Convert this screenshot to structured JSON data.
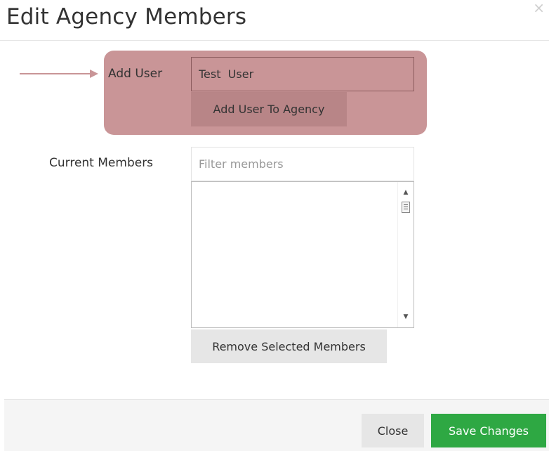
{
  "dialog": {
    "title": "Edit Agency Members",
    "close_icon": "×"
  },
  "add_user": {
    "label": "Add User",
    "input_value": "Test  User",
    "button_label": "Add User To Agency",
    "highlight_color": "#c99597",
    "arrow_color": "#c99597"
  },
  "members": {
    "label": "Current Members",
    "filter_placeholder": "Filter members",
    "items": [],
    "remove_button_label": "Remove Selected Members"
  },
  "footer": {
    "close_label": "Close",
    "save_label": "Save Changes",
    "save_color": "#2ea843"
  }
}
